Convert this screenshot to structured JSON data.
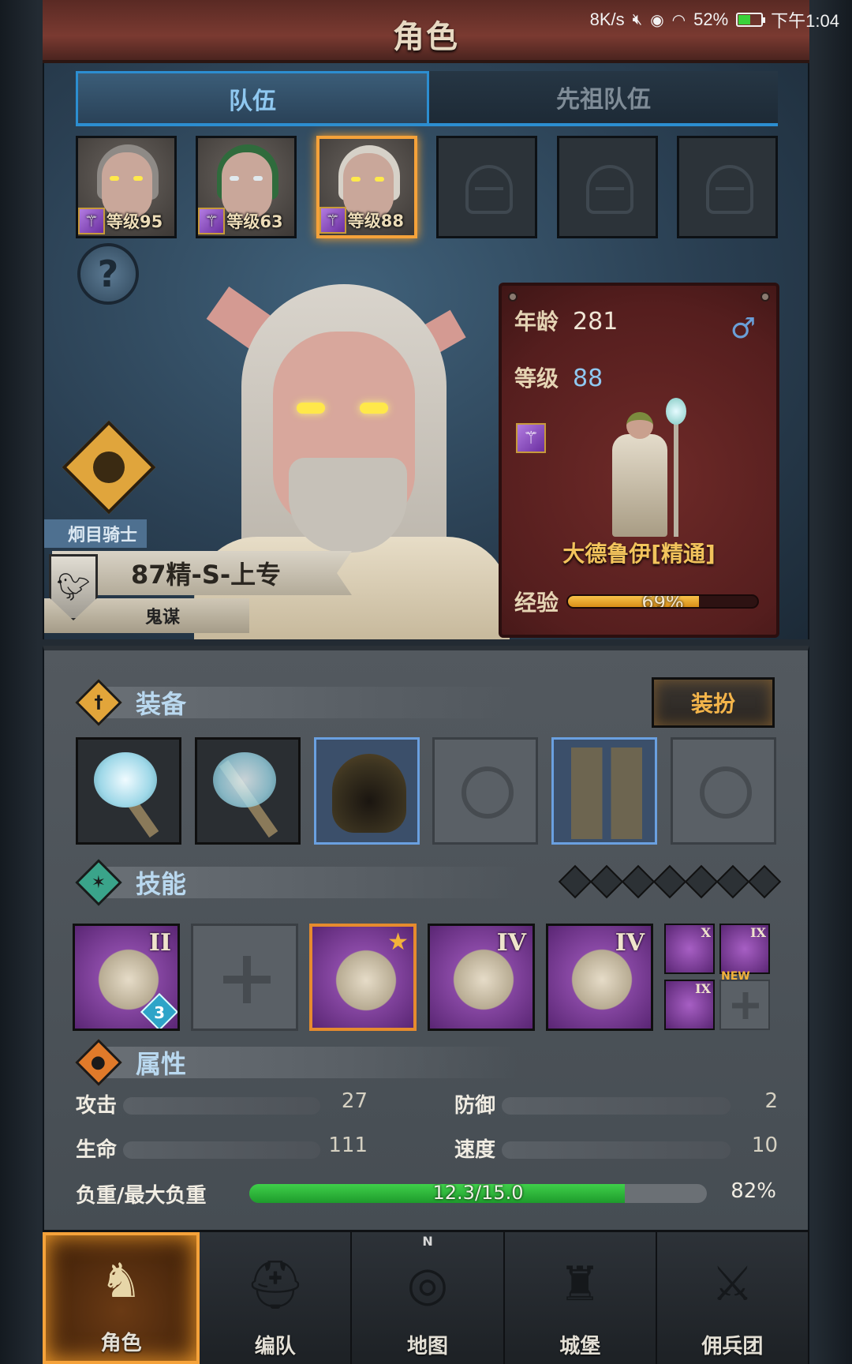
{
  "status_bar": {
    "speed": "8K/s",
    "mute_icon": "mute-icon",
    "eye_icon": "eye-comfort-icon",
    "wifi_icon": "wifi-icon",
    "battery": "52%",
    "battery_level": 0.52,
    "time": "下午1:04"
  },
  "header": {
    "title": "角色"
  },
  "tabs": [
    {
      "label": "队伍",
      "active": true
    },
    {
      "label": "先祖队伍",
      "active": false
    }
  ],
  "team": [
    {
      "level_label": "等级95",
      "hair_color": "#8e8a86",
      "selected": false
    },
    {
      "level_label": "等级63",
      "hair_color": "#2f6b3c",
      "selected": false
    },
    {
      "level_label": "等级88",
      "hair_color": "#d6d1c8",
      "selected": true
    },
    {
      "empty": true
    },
    {
      "empty": true
    },
    {
      "empty": true
    }
  ],
  "hero": {
    "title": "炯目骑士",
    "name": "87精-S-上专",
    "subtitle": "鬼谋",
    "faction_icon": "raven-shield-icon"
  },
  "info": {
    "age_label": "年龄",
    "age": "281",
    "level_label": "等级",
    "level": "88",
    "gender_icon": "male-icon",
    "class_name": "大德鲁伊[精通]",
    "exp_label": "经验",
    "exp_percent": "69%",
    "exp_fraction": 0.69
  },
  "equipment": {
    "title": "装备",
    "outfit_label": "装扮",
    "slots": [
      {
        "icon": "crystal-staff-icon",
        "style": "dark"
      },
      {
        "icon": "crystal-staff-icon",
        "style": "dark"
      },
      {
        "icon": "hood-icon",
        "style": "blue"
      },
      {
        "icon": "armor-placeholder-icon",
        "style": "empty"
      },
      {
        "icon": "boots-icon",
        "style": "blue"
      },
      {
        "icon": "ring-placeholder-icon",
        "style": "empty"
      }
    ]
  },
  "skills": {
    "title": "技能",
    "gem_count": 7,
    "slots": [
      {
        "icon": "tornado-skill-icon",
        "rank": "II",
        "rune": "3",
        "style": "normal"
      },
      {
        "icon": "empty-skill-cross-icon",
        "style": "empty"
      },
      {
        "icon": "crystal-tornado-skill-icon",
        "style": "orange",
        "star": true
      },
      {
        "icon": "crystal-hand-skill-icon",
        "rank": "IV",
        "style": "normal"
      },
      {
        "icon": "radiant-staff-skill-icon",
        "rank": "IV",
        "style": "normal"
      }
    ],
    "mini": [
      {
        "icon": "burst-skill-icon",
        "rank": "X"
      },
      {
        "icon": "radiance-skill-icon",
        "rank": "IX"
      },
      {
        "icon": "spear-skill-icon",
        "rank": "IX"
      },
      {
        "icon": "empty-skill-cross-icon",
        "new": "NEW",
        "empty": true
      }
    ]
  },
  "attributes": {
    "title": "属性",
    "attack_label": "攻击",
    "attack": "27",
    "defense_label": "防御",
    "defense": "2",
    "hp_label": "生命",
    "hp": "111",
    "speed_label": "速度",
    "speed": "10",
    "weight_label": "负重/最大负重",
    "weight": "12.3/15.0",
    "weight_fraction": 0.82,
    "weight_percent": "82%"
  },
  "nav": [
    {
      "label": "角色",
      "icon": "knight-icon",
      "active": true
    },
    {
      "label": "编队",
      "icon": "helmet-icon",
      "active": false
    },
    {
      "label": "地图",
      "icon": "compass-icon",
      "active": false,
      "north": "N"
    },
    {
      "label": "城堡",
      "icon": "castle-icon",
      "active": false
    },
    {
      "label": "佣兵团",
      "icon": "mercenary-icon",
      "active": false
    }
  ],
  "colors": {
    "accent_orange": "#f5a23a",
    "tab_blue": "#2c8ed1",
    "gold_text": "#f2c35c",
    "weight_green": "#3fd04a"
  }
}
